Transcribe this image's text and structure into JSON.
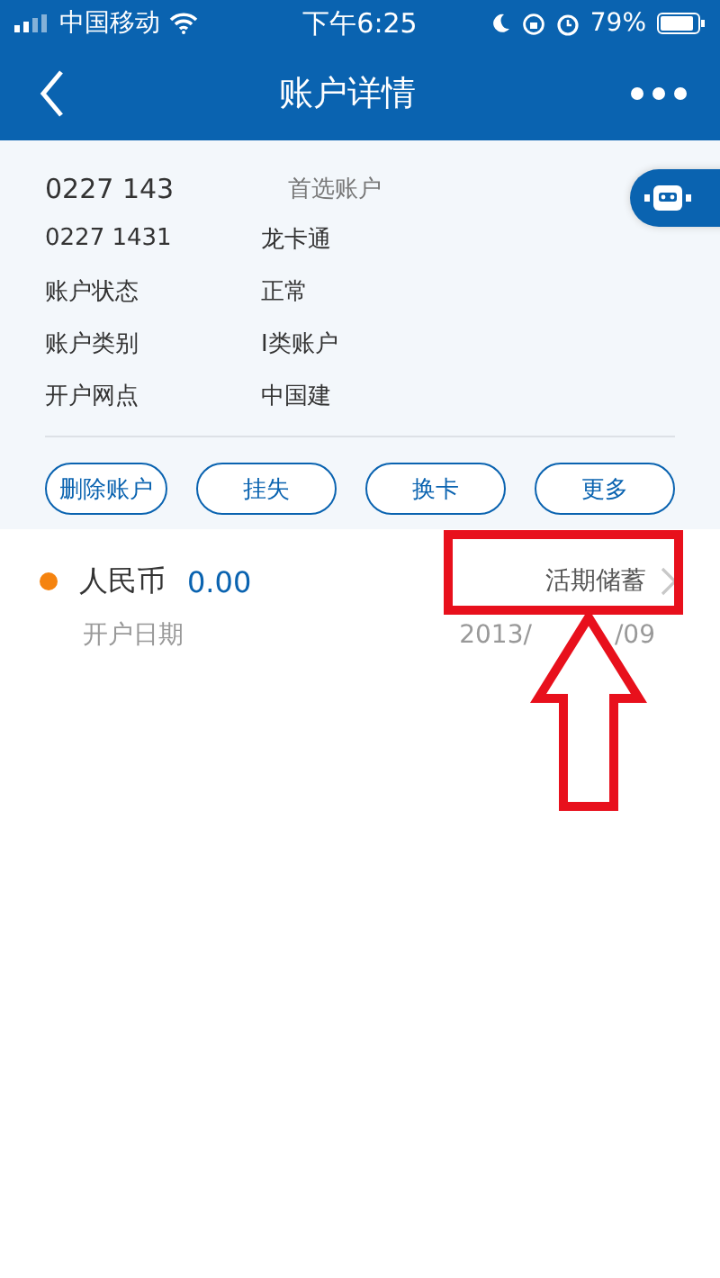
{
  "status_bar": {
    "carrier": "中国移动",
    "time": "下午6:25",
    "battery": "79%"
  },
  "nav": {
    "title": "账户详情"
  },
  "account": {
    "number": "0227 143",
    "tag": "首选账户",
    "fields": [
      {
        "label": "0227 1431",
        "value": "龙卡通"
      },
      {
        "label": "账户状态",
        "value": "正常"
      },
      {
        "label": "账户类别",
        "value": "I类账户"
      },
      {
        "label": "开户网点",
        "value": "中国建"
      }
    ]
  },
  "actions": [
    "删除账户",
    "挂失",
    "换卡",
    "更多"
  ],
  "sub_accounts": [
    {
      "currency": "人民币",
      "balance": "0.00",
      "type": "活期储蓄",
      "date_label": "开户日期",
      "date_parts": [
        "2013/",
        "/09"
      ],
      "color": "#f5830f"
    }
  ]
}
